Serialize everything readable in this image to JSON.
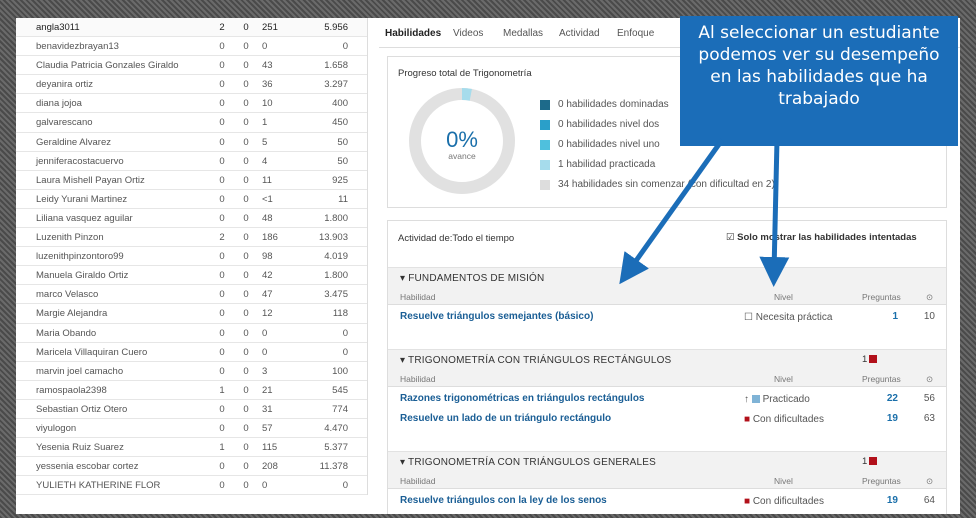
{
  "students": [
    {
      "name": "angla3011",
      "a": "2",
      "b": "0",
      "c": "251",
      "d": "5.956"
    },
    {
      "name": "benavidezbrayan13",
      "a": "0",
      "b": "0",
      "c": "0",
      "d": "0"
    },
    {
      "name": "Claudia Patricia Gonzales Giraldo",
      "a": "0",
      "b": "0",
      "c": "43",
      "d": "1.658"
    },
    {
      "name": "deyanira ortiz",
      "a": "0",
      "b": "0",
      "c": "36",
      "d": "3.297"
    },
    {
      "name": "diana jojoa",
      "a": "0",
      "b": "0",
      "c": "10",
      "d": "400"
    },
    {
      "name": "galvarescano",
      "a": "0",
      "b": "0",
      "c": "1",
      "d": "450"
    },
    {
      "name": "Geraldine Alvarez",
      "a": "0",
      "b": "0",
      "c": "5",
      "d": "50"
    },
    {
      "name": "jenniferacostacuervo",
      "a": "0",
      "b": "0",
      "c": "4",
      "d": "50"
    },
    {
      "name": "Laura Mishell Payan Ortiz",
      "a": "0",
      "b": "0",
      "c": "11",
      "d": "925"
    },
    {
      "name": "Leidy Yurani Martinez",
      "a": "0",
      "b": "0",
      "c": "<1",
      "d": "11"
    },
    {
      "name": "Liliana vasquez aguilar",
      "a": "0",
      "b": "0",
      "c": "48",
      "d": "1.800"
    },
    {
      "name": "Luzenith Pinzon",
      "a": "2",
      "b": "0",
      "c": "186",
      "d": "13.903"
    },
    {
      "name": "luzenithpinzontoro99",
      "a": "0",
      "b": "0",
      "c": "98",
      "d": "4.019"
    },
    {
      "name": "Manuela Giraldo Ortiz",
      "a": "0",
      "b": "0",
      "c": "42",
      "d": "1.800"
    },
    {
      "name": "marco Velasco",
      "a": "0",
      "b": "0",
      "c": "47",
      "d": "3.475"
    },
    {
      "name": "Margie Alejandra",
      "a": "0",
      "b": "0",
      "c": "12",
      "d": "118"
    },
    {
      "name": "Maria Obando",
      "a": "0",
      "b": "0",
      "c": "0",
      "d": "0"
    },
    {
      "name": "Maricela Villaquiran Cuero",
      "a": "0",
      "b": "0",
      "c": "0",
      "d": "0"
    },
    {
      "name": "marvin joel camacho",
      "a": "0",
      "b": "0",
      "c": "3",
      "d": "100"
    },
    {
      "name": "ramospaola2398",
      "a": "1",
      "b": "0",
      "c": "21",
      "d": "545"
    },
    {
      "name": "Sebastian Ortiz Otero",
      "a": "0",
      "b": "0",
      "c": "31",
      "d": "774"
    },
    {
      "name": "viyulogon",
      "a": "0",
      "b": "0",
      "c": "57",
      "d": "4.470"
    },
    {
      "name": "Yesenia Ruiz Suarez",
      "a": "1",
      "b": "0",
      "c": "115",
      "d": "5.377"
    },
    {
      "name": "yessenia escobar cortez",
      "a": "0",
      "b": "0",
      "c": "208",
      "d": "11.378"
    },
    {
      "name": "YULIETH KATHERINE FLOR",
      "a": "0",
      "b": "0",
      "c": "0",
      "d": "0"
    }
  ],
  "tabs": [
    "Habilidades",
    "Videos",
    "Medallas",
    "Actividad",
    "Enfoque"
  ],
  "progress": {
    "title": "Progreso total de Trigonometría",
    "percent": "0%",
    "percent_label": "avance",
    "legend": [
      {
        "text": "0 habilidades dominadas",
        "color": "#1d6a8a"
      },
      {
        "text": "0 habilidades nivel dos",
        "color": "#2a9fc9"
      },
      {
        "text": "0 habilidades nivel uno",
        "color": "#4fc0dd"
      },
      {
        "text": "1 habilidad practicada",
        "color": "#a6dcec"
      },
      {
        "text": "34 habilidades sin comenzar (con dificultad en 2)",
        "color": "#dddddd"
      }
    ],
    "practiced_fraction": 0.03
  },
  "activity": {
    "title": "Actividad de:Todo el tiempo",
    "checkbox_icon": "☑",
    "checkbox_label": "Solo mostrar las habilidades intentadas",
    "col_skill": "Habilidad",
    "col_level": "Nivel",
    "col_questions": "Preguntas",
    "col_time_icon": "⊙",
    "sections": [
      {
        "title": "FUNDAMENTOS DE MISIÓN",
        "count": "",
        "rows": [
          {
            "skill": "Resuelve triángulos semejantes (básico)",
            "level_icon": "☐",
            "level": "Necesita práctica",
            "questions": "1",
            "time": "10"
          }
        ]
      },
      {
        "title": "TRIGONOMETRÍA CON TRIÁNGULOS RECTÁNGULOS",
        "count": "1",
        "rows": [
          {
            "skill": "Razones trigonométricas en triángulos rectángulos",
            "level_icon": "↑",
            "level": "Practicado",
            "questions": "22",
            "time": "56"
          },
          {
            "skill": "Resuelve un lado de un triángulo rectángulo",
            "level_icon": "■",
            "level": "Con dificultades",
            "questions": "19",
            "time": "63"
          }
        ]
      },
      {
        "title": "TRIGONOMETRÍA CON TRIÁNGULOS GENERALES",
        "count": "1",
        "rows": [
          {
            "skill": "Resuelve triángulos con la ley de los senos",
            "level_icon": "■",
            "level": "Con dificultades",
            "questions": "19",
            "time": "64"
          }
        ]
      }
    ]
  },
  "callout": {
    "lines": [
      "Al seleccionar un estudiante",
      "podemos ver su desempeño",
      "en las habilidades que ha",
      "trabajado"
    ],
    "color": "#1b6db8"
  }
}
